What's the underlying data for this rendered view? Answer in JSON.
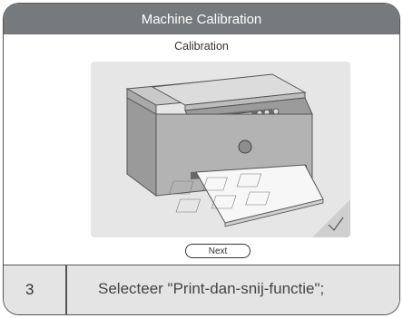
{
  "dialog": {
    "title": "Machine Calibration",
    "subtitle": "Calibration",
    "next_label": "Next"
  },
  "step": {
    "number": "3",
    "instruction": "Selecteer \"Print-dan-snij-functie\";"
  },
  "colors": {
    "titlebar": "#777a7c",
    "footer": "#e4e4e4",
    "illustration_bg": "#e6e6e6"
  }
}
